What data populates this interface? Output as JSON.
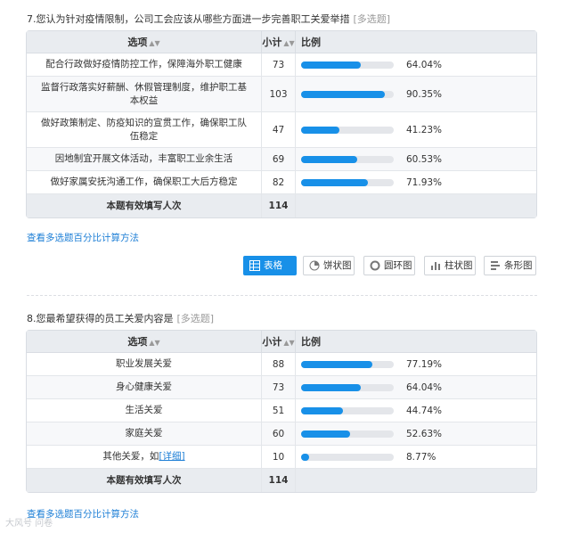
{
  "q7": {
    "title": "7.您认为针对疫情限制，公司工会应该从哪些方面进一步完善职工关爱举措",
    "type": "[多选题]",
    "header": {
      "option": "选项",
      "count": "小计",
      "percent": "比例"
    },
    "rows": [
      {
        "option": "配合行政做好疫情防控工作，保障海外职工健康",
        "count": "73",
        "percent": "64.04%",
        "ratio": 0.6404
      },
      {
        "option": "监督行政落实好薪酬、休假管理制度，维护职工基本权益",
        "count": "103",
        "percent": "90.35%",
        "ratio": 0.9035
      },
      {
        "option": "做好政策制定、防疫知识的宣贯工作，确保职工队伍稳定",
        "count": "47",
        "percent": "41.23%",
        "ratio": 0.4123
      },
      {
        "option": "因地制宜开展文体活动，丰富职工业余生活",
        "count": "69",
        "percent": "60.53%",
        "ratio": 0.6053
      },
      {
        "option": "做好家属安抚沟通工作，确保职工大后方稳定",
        "count": "82",
        "percent": "71.93%",
        "ratio": 0.7193
      }
    ],
    "total": {
      "label": "本题有效填写人次",
      "count": "114"
    },
    "calc_link": "查看多选题百分比计算方法"
  },
  "view_buttons": {
    "table": "表格",
    "pie": "饼状图",
    "ring": "圆环图",
    "bar": "柱状图",
    "hbar": "条形图"
  },
  "q8": {
    "title": "8.您最希望获得的员工关爱内容是",
    "type": "[多选题]",
    "header": {
      "option": "选项",
      "count": "小计",
      "percent": "比例"
    },
    "rows": [
      {
        "option": "职业发展关爱",
        "count": "88",
        "percent": "77.19%",
        "ratio": 0.7719
      },
      {
        "option": "身心健康关爱",
        "count": "73",
        "percent": "64.04%",
        "ratio": 0.6404
      },
      {
        "option": "生活关爱",
        "count": "51",
        "percent": "44.74%",
        "ratio": 0.4474
      },
      {
        "option": "家庭关爱",
        "count": "60",
        "percent": "52.63%",
        "ratio": 0.5263
      },
      {
        "option": "其他关爱，如",
        "detail": "[详细]",
        "count": "10",
        "percent": "8.77%",
        "ratio": 0.0877
      }
    ],
    "total": {
      "label": "本题有效填写人次",
      "count": "114"
    },
    "calc_link": "查看多选题百分比计算方法"
  },
  "watermark": "大风号 问卷"
}
